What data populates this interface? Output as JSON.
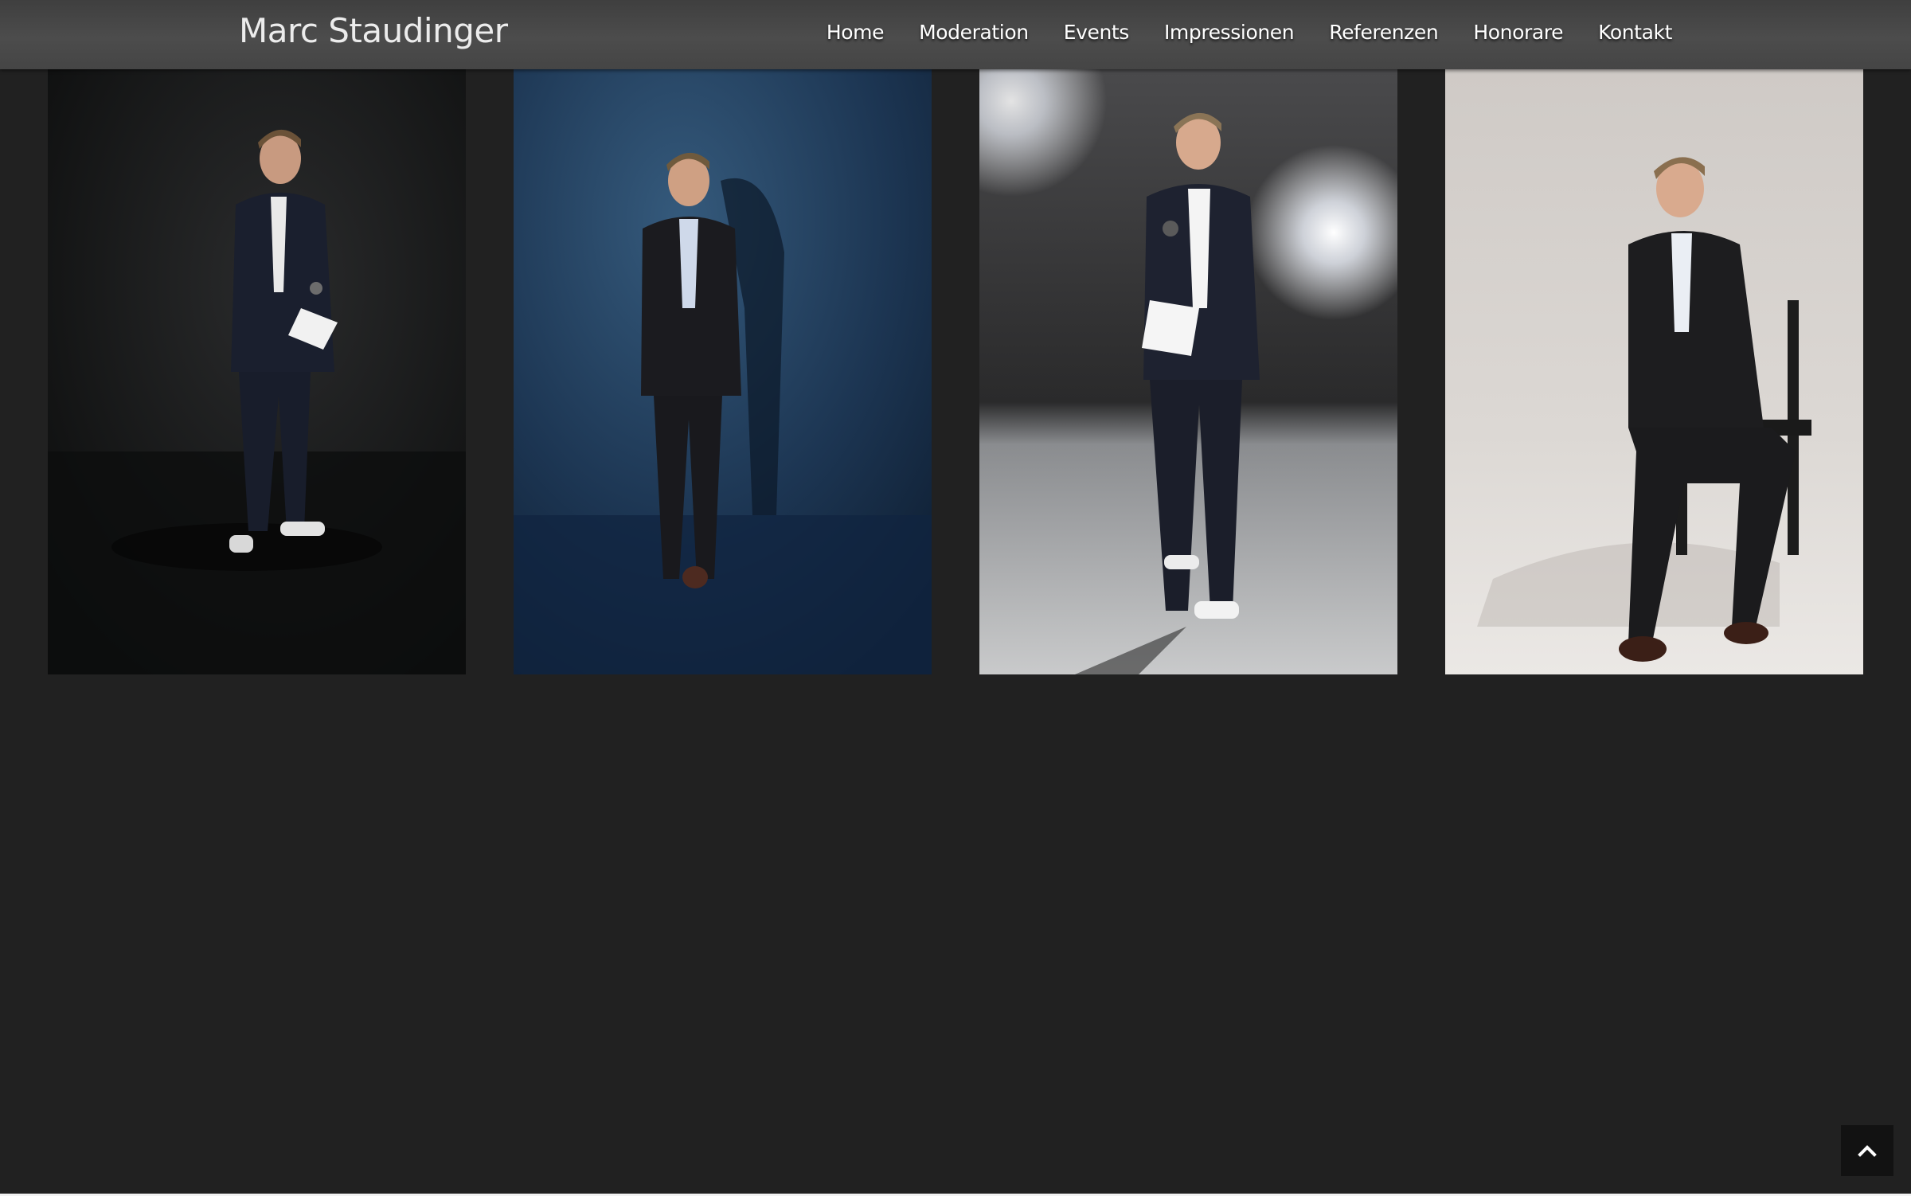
{
  "header": {
    "brand": "Marc Staudinger",
    "nav": [
      "Home",
      "Moderation",
      "Events",
      "Impressionen",
      "Referenzen",
      "Honorare",
      "Kontakt"
    ]
  },
  "gallery": {
    "photos": [
      {
        "subject": "presenter-black-backdrop"
      },
      {
        "subject": "presenter-blue-backdrop"
      },
      {
        "subject": "presenter-stage-light"
      },
      {
        "subject": "presenter-seated-chair"
      }
    ]
  },
  "icons": {
    "back_to_top": "chevron-up-icon"
  },
  "colors": {
    "page_bg": "#212121",
    "header_bg": "#464646",
    "text": "#ffffff"
  }
}
